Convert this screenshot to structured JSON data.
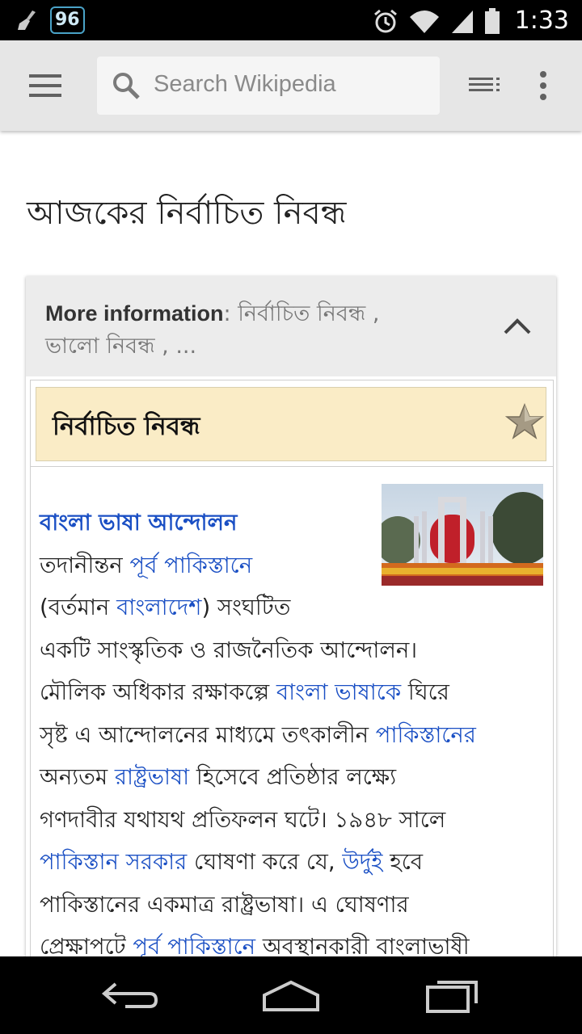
{
  "status_bar": {
    "notification_count": "96",
    "time": "1:33",
    "icons": [
      "broom-icon",
      "alarm-icon",
      "wifi-icon",
      "signal-icon",
      "battery-icon"
    ]
  },
  "toolbar": {
    "search_placeholder": "Search Wikipedia",
    "icons": [
      "menu-icon",
      "search-icon",
      "toc-icon",
      "overflow-menu-icon"
    ]
  },
  "page": {
    "title": "আজকের নির্বাচিত নিবন্ধ"
  },
  "more_info": {
    "label": "More information",
    "separator": ":",
    "line1_rest": " নির্বাচিত নিবন্ধ ,",
    "line2": "ভালো নিবন্ধ , ..."
  },
  "featured": {
    "title": "নির্বাচিত নিবন্ধ",
    "accent": "#faecc6"
  },
  "article": {
    "lead_link": "বাংলা ভাষা আন্দোলন",
    "l2_t1": "তদানীন্তন ",
    "l2_link": "পূর্ব পাকিস্তানে",
    "l3_t1": "(বর্তমান ",
    "l3_link": "বাংলাদেশ",
    "l3_t2": ") সংঘটিত",
    "l4": "একটি সাংস্কৃতিক ও রাজনৈতিক আন্দোলন।",
    "l5_t1": "মৌলিক অধিকার রক্ষাকল্পে ",
    "l5_link": "বাংলা ভাষাকে",
    "l5_t2": " ঘিরে",
    "l6_t1": "সৃষ্ট এ আন্দোলনের মাধ্যমে তৎকালীন ",
    "l6_link": "পাকিস্তানের",
    "l7_t1": "অন্যতম ",
    "l7_link": "রাষ্ট্রভাষা",
    "l7_t2": " হিসেবে প্রতিষ্ঠার লক্ষ্যে",
    "l8": "গণদাবীর যথাযথ প্রতিফলন ঘটে। ১৯৪৮ সালে",
    "l9_link1": "পাকিস্তান সরকার",
    "l9_t1": " ঘোষণা করে যে, ",
    "l9_link2": "উর্দুই",
    "l9_t2": " হবে",
    "l10": "পাকিস্তানের একমাত্র রাষ্ট্রভাষা। এ ঘোষণার",
    "l11_t1": "প্রেক্ষাপটে ",
    "l11_link": "পূর্ব পাকিস্তানে",
    "l11_t2": " অবস্থানকারী বাংলাভাষী",
    "link_color": "#1a4fc4"
  },
  "nav_bar": {
    "icons": [
      "back-icon",
      "home-icon",
      "recents-icon"
    ]
  }
}
